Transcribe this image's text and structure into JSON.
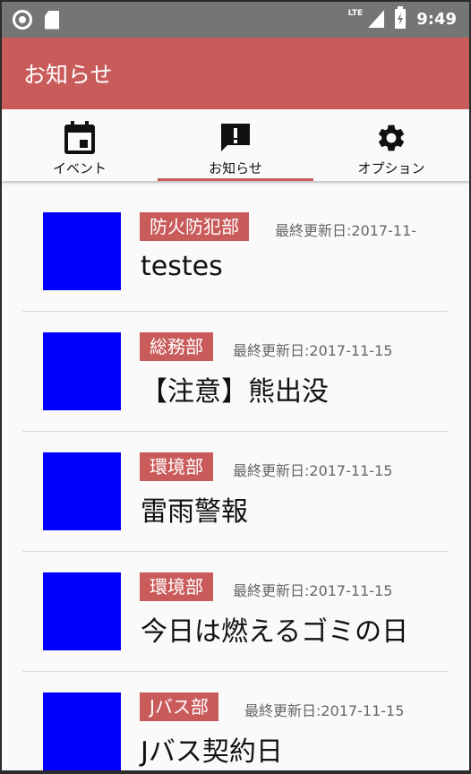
{
  "status_bar": {
    "network": "LTE",
    "time": "9:49"
  },
  "toolbar": {
    "title": "お知らせ"
  },
  "tabs": [
    {
      "label": "イベント",
      "icon": "calendar-icon",
      "active": false
    },
    {
      "label": "お知らせ",
      "icon": "notification-icon",
      "active": true
    },
    {
      "label": "オプション",
      "icon": "gear-icon",
      "active": false
    }
  ],
  "colors": {
    "accent": "#c95b5b",
    "status_bar": "#757575",
    "thumbnail": "#0000ff"
  },
  "notices": [
    {
      "dept": "防火防犯部",
      "date": "最終更新日:2017-11-",
      "title": "testes"
    },
    {
      "dept": "総務部",
      "date": "最終更新日:2017-11-15",
      "title": "【注意】熊出没"
    },
    {
      "dept": "環境部",
      "date": "最終更新日:2017-11-15",
      "title": "雷雨警報"
    },
    {
      "dept": "環境部",
      "date": "最終更新日:2017-11-15",
      "title": "今日は燃えるゴミの日"
    },
    {
      "dept": "Jバス部",
      "date": "最終更新日:2017-11-15",
      "title": "Jバス契約日"
    }
  ]
}
